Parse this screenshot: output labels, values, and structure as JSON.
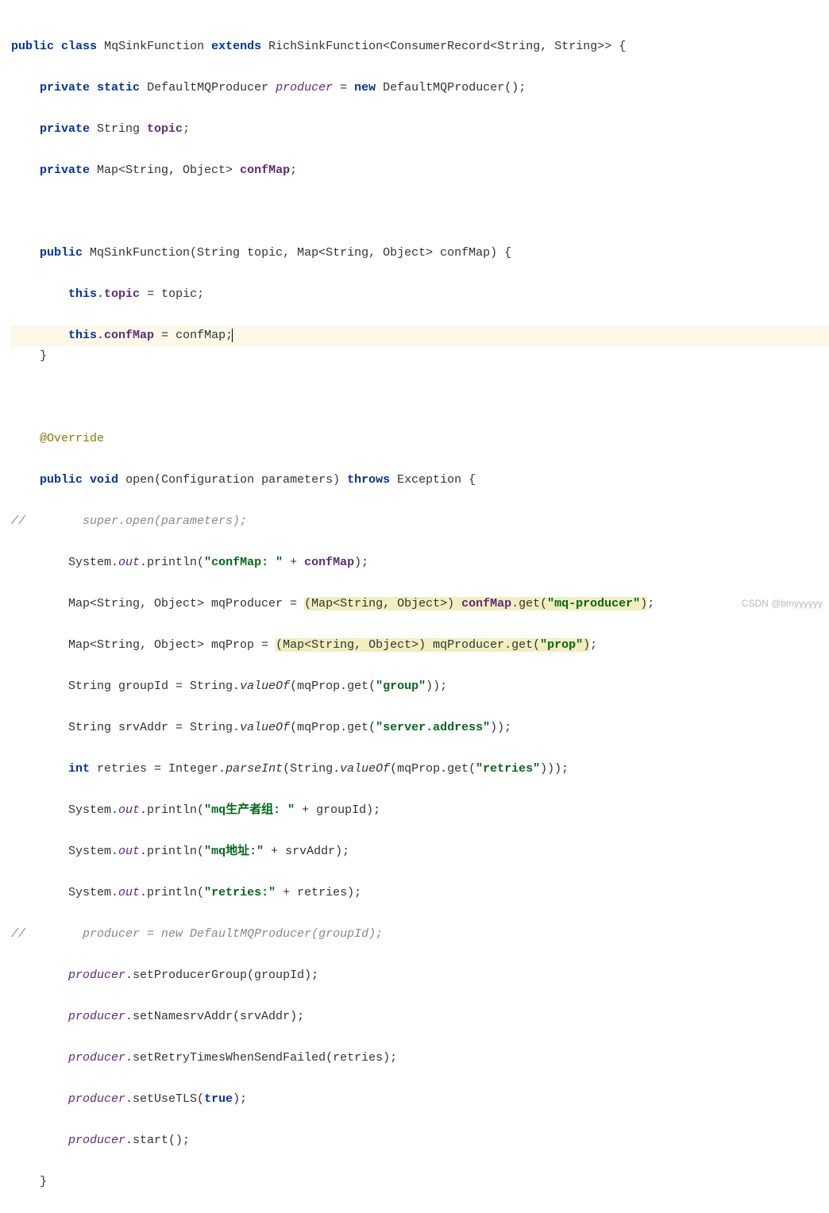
{
  "watermark": "CSDN @bmyyyyyy",
  "code": {
    "l1_public": "public",
    "l1_class": "class",
    "l1_cname": "MqSinkFunction",
    "l1_extends": "extends",
    "l1_parent": "RichSinkFunction<ConsumerRecord<String, String>>",
    "l1_brace": " {",
    "l2_private": "private",
    "l2_static": "static",
    "l2_type": "DefaultMQProducer",
    "l2_field": "producer",
    "l2_eq": " = ",
    "l2_new": "new",
    "l2_ctor": " DefaultMQProducer();",
    "l3_private": "private",
    "l3_type": " String ",
    "l3_field": "topic",
    "l3_semi": ";",
    "l4_private": "private",
    "l4_type": " Map<String, Object> ",
    "l4_field": "confMap",
    "l4_semi": ";",
    "l6_public": "public",
    "l6_sig": " MqSinkFunction(String topic, Map<String, Object> confMap) {",
    "l7_this": "this",
    "l7_dot": ".",
    "l7_field": "topic",
    "l7_rest": " = topic;",
    "l8_this": "this",
    "l8_dot": ".",
    "l8_field": "confMap",
    "l8_rest": " = confMap;",
    "l9_brace": "}",
    "l11_ann": "@Override",
    "l12_public": "public",
    "l12_void": "void",
    "l12_name": " open(Configuration parameters) ",
    "l12_throws": "throws",
    "l12_ex": " Exception {",
    "l13_slashes": "//",
    "l13_comment": "super.open(parameters);",
    "l14_sys": "System.",
    "l14_out": "out",
    "l14_print": ".println(",
    "l14_str": "\"confMap: \"",
    "l14_plus": " + ",
    "l14_field": "confMap",
    "l14_end": ");",
    "l15_decl": "Map<String, Object> mqProducer = ",
    "l15_cast": "(Map<String, Object>) ",
    "l15_field": "confMap",
    "l15_get": ".get(",
    "l15_str": "\"mq-producer\"",
    "l15_end": ");",
    "l16_decl": "Map<String, Object> mqProp = ",
    "l16_cast": "(Map<String, Object>)",
    "l16_rest1": " mqProducer.get(",
    "l16_str": "\"prop\"",
    "l16_end": ");",
    "l17_decl": "String groupId = String.",
    "l17_valueof": "valueOf",
    "l17_rest": "(mqProp.get(",
    "l17_str": "\"group\"",
    "l17_end": "));",
    "l18_decl": "String srvAddr = String.",
    "l18_valueof": "valueOf",
    "l18_rest": "(mqProp.get(",
    "l18_str": "\"server.address\"",
    "l18_end": "));",
    "l19_int": "int",
    "l19_decl": " retries = Integer.",
    "l19_parseint": "parseInt",
    "l19_p1": "(String.",
    "l19_valueof": "valueOf",
    "l19_p2": "(mqProp.get(",
    "l19_str": "\"retries\"",
    "l19_end": ")));",
    "l20_sys": "System.",
    "l20_out": "out",
    "l20_print": ".println(",
    "l20_str": "\"mq生产者组: \"",
    "l20_rest": " + groupId);",
    "l21_sys": "System.",
    "l21_out": "out",
    "l21_print": ".println(",
    "l21_str": "\"mq地址:\"",
    "l21_rest": " + srvAddr);",
    "l22_sys": "System.",
    "l22_out": "out",
    "l22_print": ".println(",
    "l22_str": "\"retries:\"",
    "l22_rest": " + retries);",
    "l23_slashes": "//",
    "l23_comment": "producer = new DefaultMQProducer(groupId);",
    "l24_prod": "producer",
    "l24_rest": ".setProducerGroup(groupId);",
    "l25_prod": "producer",
    "l25_rest": ".setNamesrvAddr(srvAddr);",
    "l26_prod": "producer",
    "l26_rest": ".setRetryTimesWhenSendFailed(retries);",
    "l27_prod": "producer",
    "l27_rest": ".setUseTLS(",
    "l27_true": "true",
    "l27_end": ");",
    "l28_prod": "producer",
    "l28_rest": ".start();",
    "l29_brace": "}"
  }
}
